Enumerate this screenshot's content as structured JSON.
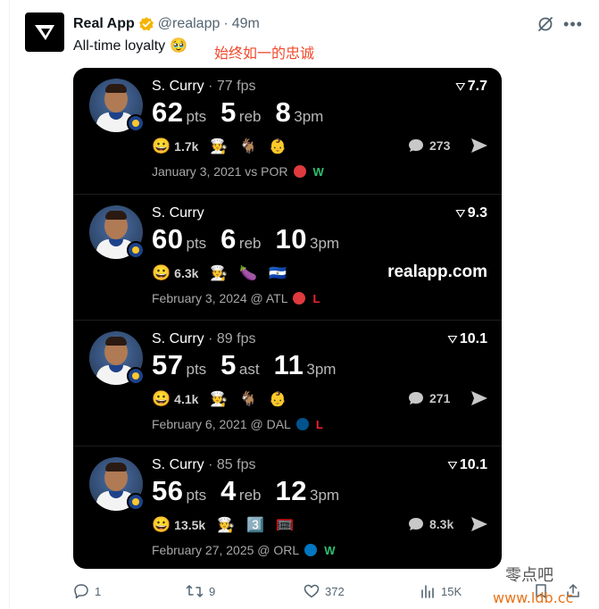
{
  "tweet": {
    "author_name": "Real App",
    "handle": "@realapp",
    "separator": "·",
    "time": "49m",
    "text": "All-time loyalty",
    "text_emoji": "🥹",
    "overlay_caption": "始终如一的忠诚"
  },
  "cards": [
    {
      "player": "S. Curry",
      "fps": "· 77 fps",
      "score": "7.7",
      "stats": [
        {
          "num": "62",
          "unit": "pts"
        },
        {
          "num": "5",
          "unit": "reb"
        },
        {
          "num": "8",
          "unit": "3pm"
        }
      ],
      "reactions_count": "1.7k",
      "emojis": [
        "🧑‍🍳",
        "🐐",
        "👶"
      ],
      "comments": "273",
      "watermark": "",
      "game": "January 3, 2021 vs POR",
      "result": "W",
      "team_color": "#e03a3e"
    },
    {
      "player": "S. Curry",
      "fps": "",
      "score": "9.3",
      "stats": [
        {
          "num": "60",
          "unit": "pts"
        },
        {
          "num": "6",
          "unit": "reb"
        },
        {
          "num": "10",
          "unit": "3pm"
        }
      ],
      "reactions_count": "6.3k",
      "emojis": [
        "🧑‍🍳",
        "🍆",
        "🇸🇻"
      ],
      "comments": "",
      "watermark": "realapp.com",
      "game": "February 3, 2024 @ ATL",
      "result": "L",
      "team_color": "#e03a3e"
    },
    {
      "player": "S. Curry",
      "fps": "· 89 fps",
      "score": "10.1",
      "stats": [
        {
          "num": "57",
          "unit": "pts"
        },
        {
          "num": "5",
          "unit": "ast"
        },
        {
          "num": "11",
          "unit": "3pm"
        }
      ],
      "reactions_count": "4.1k",
      "emojis": [
        "🧑‍🍳",
        "🐐",
        "👶"
      ],
      "comments": "271",
      "watermark": "",
      "game": "February 6, 2021 @ DAL",
      "result": "L",
      "team_color": "#00538c"
    },
    {
      "player": "S. Curry",
      "fps": "· 85 fps",
      "score": "10.1",
      "stats": [
        {
          "num": "56",
          "unit": "pts"
        },
        {
          "num": "4",
          "unit": "reb"
        },
        {
          "num": "12",
          "unit": "3pm"
        }
      ],
      "reactions_count": "13.5k",
      "emojis": [
        "🧑‍🍳",
        "3️⃣",
        "🥅"
      ],
      "comments": "8.3k",
      "watermark": "",
      "game": "February 27, 2025 @ ORL",
      "result": "W",
      "team_color": "#0077c0"
    }
  ],
  "actions": {
    "replies": "1",
    "reposts": "9",
    "likes": "372",
    "views": "15K"
  },
  "site_watermark": {
    "chinese": "零点吧",
    "url": "www.ldb.cc"
  },
  "colors": {
    "win": "#2fbf71",
    "loss": "#f4212e",
    "verified": "#f4b400",
    "caption": "#f2492c"
  }
}
